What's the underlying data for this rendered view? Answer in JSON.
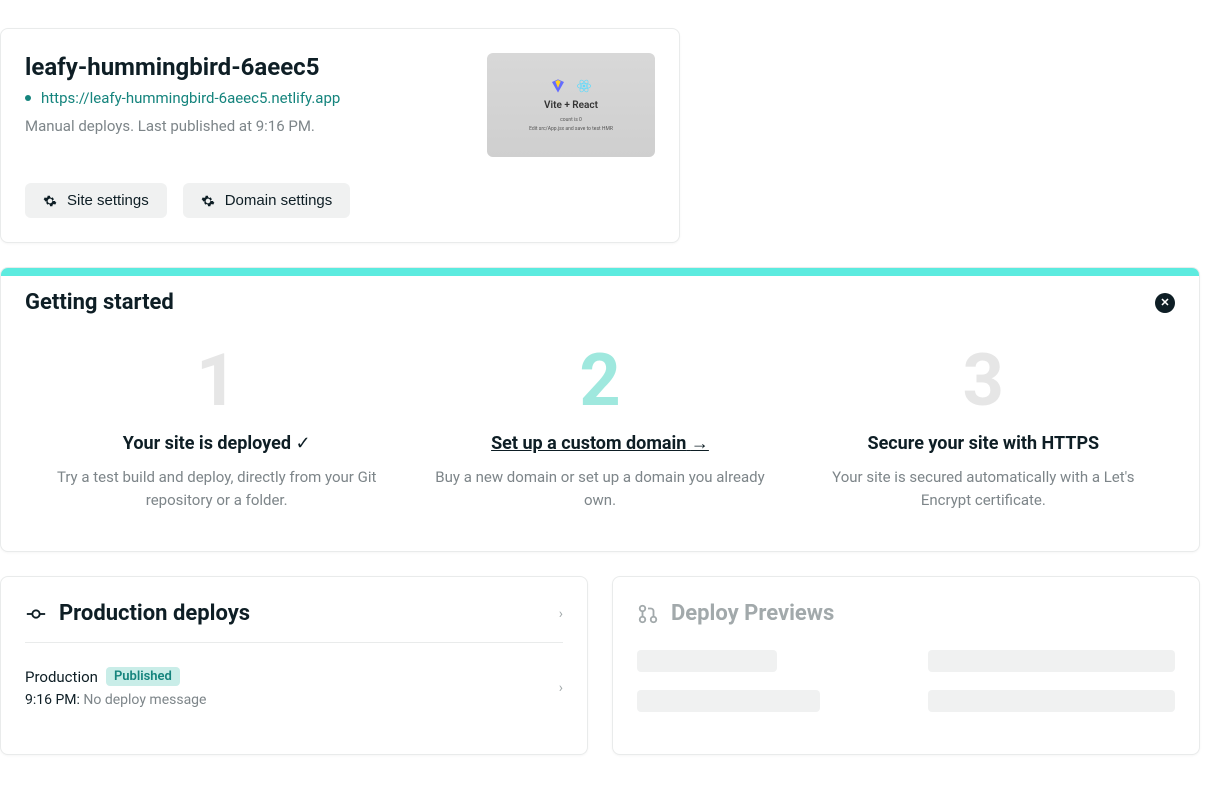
{
  "site": {
    "name": "leafy-hummingbird-6aeec5",
    "url": "https://leafy-hummingbird-6aeec5.netlify.app",
    "meta": "Manual deploys. Last published at 9:16 PM.",
    "preview_title": "Vite + React"
  },
  "actions": {
    "site_settings": "Site settings",
    "domain_settings": "Domain settings"
  },
  "getting_started": {
    "title": "Getting started",
    "steps": [
      {
        "num": "1",
        "title": "Your site is deployed",
        "suffix": "✓",
        "desc": "Try a test build and deploy, directly from your Git repository or a folder."
      },
      {
        "num": "2",
        "title": "Set up a custom domain",
        "suffix": "→",
        "desc": "Buy a new domain or set up a domain you already own."
      },
      {
        "num": "3",
        "title": "Secure your site with HTTPS",
        "suffix": "",
        "desc": "Your site is secured automatically with a Let's Encrypt certificate."
      }
    ]
  },
  "production_deploys": {
    "title": "Production deploys",
    "item": {
      "env": "Production",
      "badge": "Published",
      "time": "9:16 PM:",
      "msg": "No deploy message"
    }
  },
  "deploy_previews": {
    "title": "Deploy Previews"
  }
}
